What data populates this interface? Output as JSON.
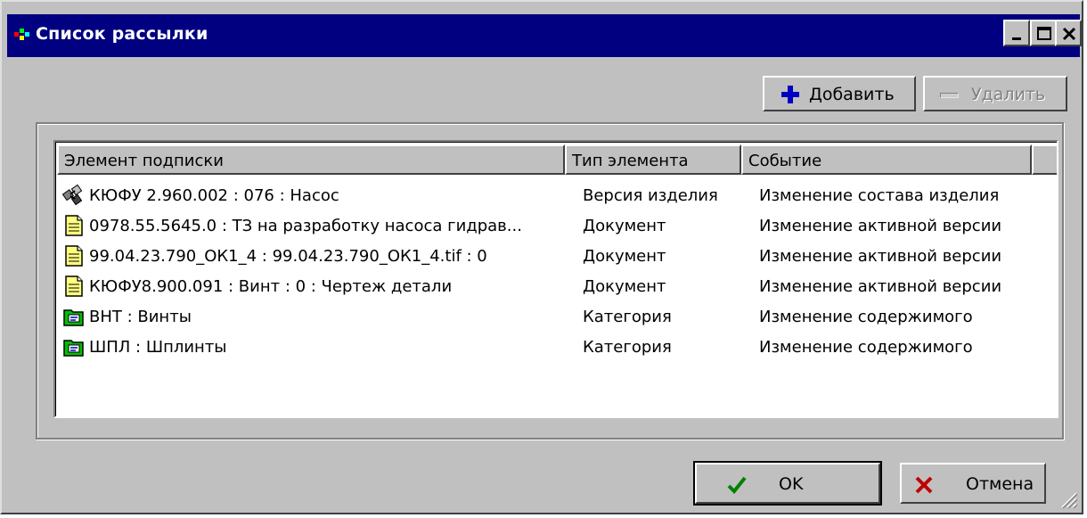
{
  "window": {
    "title": "Список рассылки",
    "caption_buttons": [
      "minimize-icon",
      "maximize-icon",
      "close-icon"
    ]
  },
  "toolbar": {
    "add_label": "Добавить",
    "add_icon": "plus-icon",
    "delete_label": "Удалить",
    "delete_icon": "minus-icon",
    "delete_enabled": false
  },
  "list": {
    "columns": [
      "Элемент подписки",
      "Тип элемента",
      "Событие"
    ],
    "rows": [
      {
        "icon": "product-version-icon",
        "element": "КЮФУ 2.960.002 : 076 : Насос",
        "type": "Версия изделия",
        "event": "Изменение состава изделия"
      },
      {
        "icon": "document-icon",
        "element": "0978.55.5645.0 : ТЗ на разработку насоса гидрав...",
        "type": "Документ",
        "event": "Изменение активной версии"
      },
      {
        "icon": "document-icon",
        "element": "99.04.23.790_ОК1_4 : 99.04.23.790_ОК1_4.tif : 0",
        "type": "Документ",
        "event": "Изменение активной версии"
      },
      {
        "icon": "document-icon",
        "element": "КЮФУ8.900.091 : Винт : 0 : Чертеж детали",
        "type": "Документ",
        "event": "Изменение активной версии"
      },
      {
        "icon": "category-folder-icon",
        "element": "ВНТ : Винты",
        "type": "Категория",
        "event": "Изменение содержимого"
      },
      {
        "icon": "category-folder-icon",
        "element": "ШПЛ : Шплинты",
        "type": "Категория",
        "event": "Изменение содержимого"
      }
    ]
  },
  "buttons": {
    "ok_label": "OK",
    "ok_icon": "checkmark-icon",
    "cancel_label": "Отмена",
    "cancel_icon": "cross-icon"
  },
  "colors": {
    "titlebar": "#000080",
    "face": "#c0c0c0",
    "add_icon": "#0000c0",
    "ok_icon": "#008000",
    "cancel_icon": "#c00000"
  }
}
